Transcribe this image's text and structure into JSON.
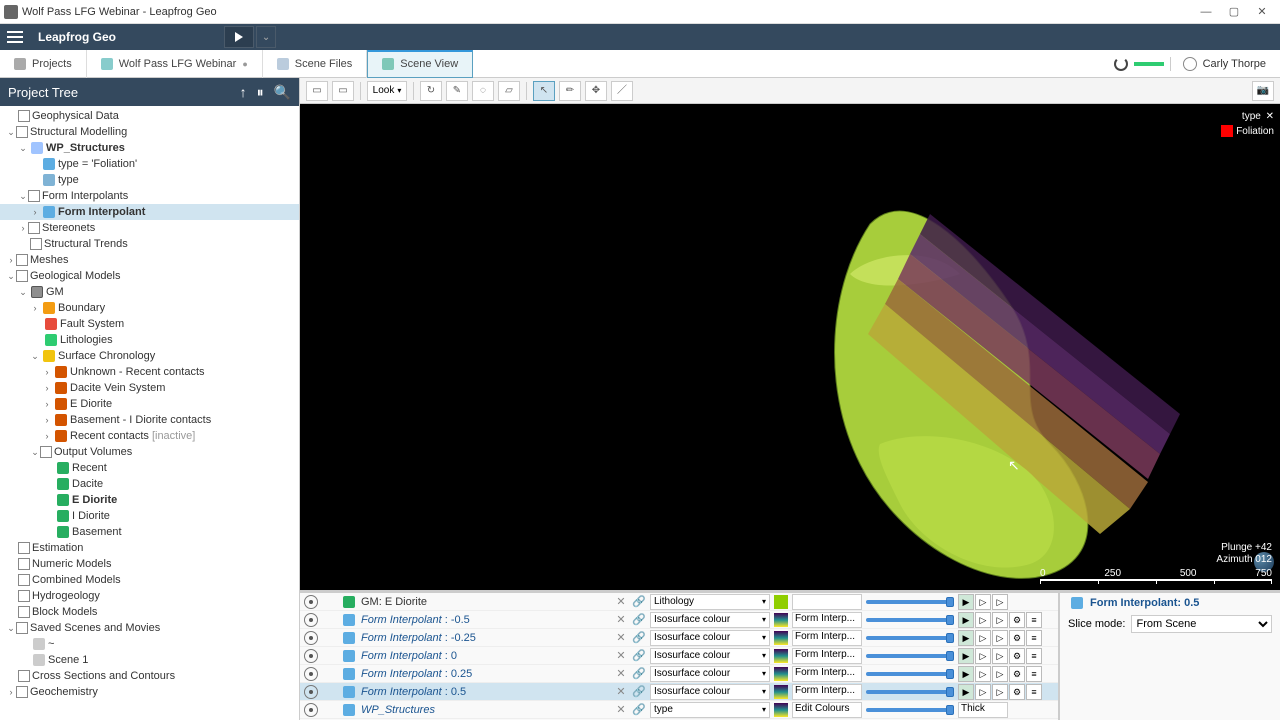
{
  "titlebar": {
    "title": "Wolf Pass LFG Webinar - Leapfrog Geo"
  },
  "header": {
    "brand": "Leapfrog Geo"
  },
  "tabs": {
    "projects": "Projects",
    "wolfpass": "Wolf Pass LFG Webinar",
    "scenefiles": "Scene Files",
    "sceneview": "Scene View"
  },
  "user": {
    "name": "Carly Thorpe"
  },
  "panel": {
    "title": "Project Tree"
  },
  "toolbar": {
    "look": "Look"
  },
  "tree": {
    "geophys": "Geophysical Data",
    "structural": "Structural Modelling",
    "wpstruct": "WP_Structures",
    "typefol": "type = 'Foliation'",
    "type": "type",
    "fi": "Form Interpolants",
    "finterp": "Form Interpolant",
    "stereo": "Stereonets",
    "trends": "Structural Trends",
    "meshes": "Meshes",
    "geomodels": "Geological Models",
    "gm": "GM",
    "boundary": "Boundary",
    "fault": "Fault System",
    "lith": "Lithologies",
    "chron": "Surface Chronology",
    "unknown": "Unknown - Recent contacts",
    "dacvein": "Dacite Vein System",
    "edio1": "E Diorite",
    "base_i": "Basement - I Diorite contacts",
    "recentc": "Recent contacts",
    "inactive": "[inactive]",
    "outvol": "Output Volumes",
    "recent": "Recent",
    "dacite": "Dacite",
    "ediorite": "E Diorite",
    "idiorite": "I Diorite",
    "basement": "Basement",
    "est": "Estimation",
    "num": "Numeric Models",
    "comb": "Combined Models",
    "hydro": "Hydrogeology",
    "block": "Block Models",
    "saved": "Saved Scenes and Movies",
    "s1a": "~",
    "scene1": "Scene 1",
    "cross": "Cross Sections and Contours",
    "geoch": "Geochemistry"
  },
  "viewport": {
    "legend_title": "type",
    "legend_item": "Foliation",
    "plunge": "Plunge +42",
    "azimuth": "Azimuth 012",
    "scale": {
      "t0": "0",
      "t1": "250",
      "t2": "500",
      "t3": "750"
    }
  },
  "layers": [
    {
      "name_prefix": "GM:",
      "name": "E Diorite",
      "attr": "Lithology",
      "legend": "",
      "gm": true
    },
    {
      "name": "Form Interpolant",
      "val": "-0.5",
      "attr": "Isosurface colour",
      "legend": "Form Interp..."
    },
    {
      "name": "Form Interpolant",
      "val": "-0.25",
      "attr": "Isosurface colour",
      "legend": "Form Interp..."
    },
    {
      "name": "Form Interpolant",
      "val": "0",
      "attr": "Isosurface colour",
      "legend": "Form Interp..."
    },
    {
      "name": "Form Interpolant",
      "val": "0.25",
      "attr": "Isosurface colour",
      "legend": "Form Interp..."
    },
    {
      "name": "Form Interpolant",
      "val": "0.5",
      "attr": "Isosurface colour",
      "legend": "Form Interp...",
      "sel": true
    },
    {
      "name": "WP_Structures",
      "val": "",
      "attr": "type",
      "legend": "Edit Colours",
      "thick": "Thick"
    }
  ],
  "rpanel": {
    "title": "Form Interpolant: 0.5",
    "slice_label": "Slice mode:",
    "slice_value": "From Scene"
  }
}
